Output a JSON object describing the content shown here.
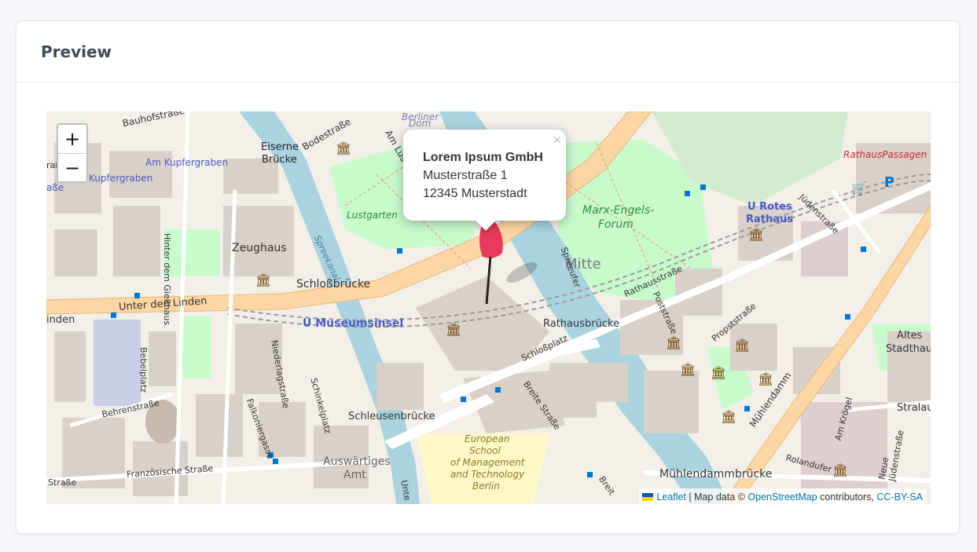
{
  "card": {
    "title": "Preview"
  },
  "map": {
    "zoom_in_label": "+",
    "zoom_out_label": "−",
    "popup": {
      "close": "×",
      "name": "Lorem Ipsum GmbH",
      "street": "Musterstraße 1",
      "city": "12345 Musterstadt"
    },
    "attribution": {
      "leaflet": "Leaflet",
      "sep": "| Map data ©",
      "osm": "OpenStreetMap",
      "contributors": "contributors,",
      "license": "CC-BY-SA"
    },
    "labels": {
      "bauhofstrasse": "Bauhofstraße",
      "bodestrasse": "Bodestraße",
      "eiserne_bruecke_1": "Eiserne",
      "eiserne_bruecke_2": "Brücke",
      "am_kupfergraben_1": "Am Kupfergraben",
      "am_kupfergraben_2": "Kupfergraben",
      "am_lustgarten": "Am Lustg",
      "berliner_dom_1": "Berliner",
      "berliner_dom_2": "Dom",
      "lustgarten": "Lustgarten",
      "zeughaus": "Zeughaus",
      "hinter_dem_giesshaus": "Hinter dem Gießhaus",
      "spreekanal": "Spreekanal",
      "schlossbruecke": "Schloßbrücke",
      "unter_den_linden": "Unter den Linden",
      "linden": "inden",
      "u_museumsinsel": "U Museumsinsel",
      "mitte": "Mitte",
      "marx_engels_1": "Marx-Engels-",
      "marx_engels_2": "Forum",
      "spreeufer": "Spreeufer",
      "rathausstrasse": "Rathausstraße",
      "u_rotes_rathaus_1": "U Rotes",
      "u_rotes_rathaus_2": "Rathaus",
      "judenstrasse": "Jüdenstraße",
      "rathauspassagen": "RathausPassagen",
      "rathausbruecke": "Rathausbrücke",
      "poststrasse": "Poststraße",
      "propststrasse": "Propststraße",
      "altes_stadthaus_1": "Altes",
      "altes_stadthaus_2": "Stadthau",
      "stralauer": "Stralau",
      "muehlendamm": "Mühlendamm",
      "schlossplatz": "Schloßplatz",
      "breite_strasse": "Breite Straße",
      "breite_2": "Breit",
      "behrenstrasse": "Behrenstraße",
      "bebelplatz": "Bebelplatz",
      "niederlagstrasse": "Niederlagstraße",
      "schinkelplatz": "Schinkelplatz",
      "falkoniergasse": "Falkoniergasse",
      "schleusenbruecke": "Schleusenbrücke",
      "esmt_1": "European",
      "esmt_2": "School",
      "esmt_3": "of Management",
      "esmt_4": "and Technology",
      "esmt_5": "Berlin",
      "auswaertiges_1": "Auswärtiges",
      "auswaertiges_2": "Amt",
      "franzoesische": "Französische Straße",
      "strasse": "Straße",
      "muehlendammbruecke": "Mühlendammbrücke",
      "rolandufer": "Rolandufer",
      "am_kroegel": "Am Krögel",
      "neue_juedenstrasse": "Neue Jüdenstraße",
      "unter": "Unte",
      "asse": "aße",
      "strasse_left": "raße"
    },
    "colors": {
      "water": "#aad3df",
      "major_road": "#fcd6a4",
      "building": "#d9d0c9",
      "park": "#c8facc",
      "marker": "#e63a5a"
    }
  }
}
